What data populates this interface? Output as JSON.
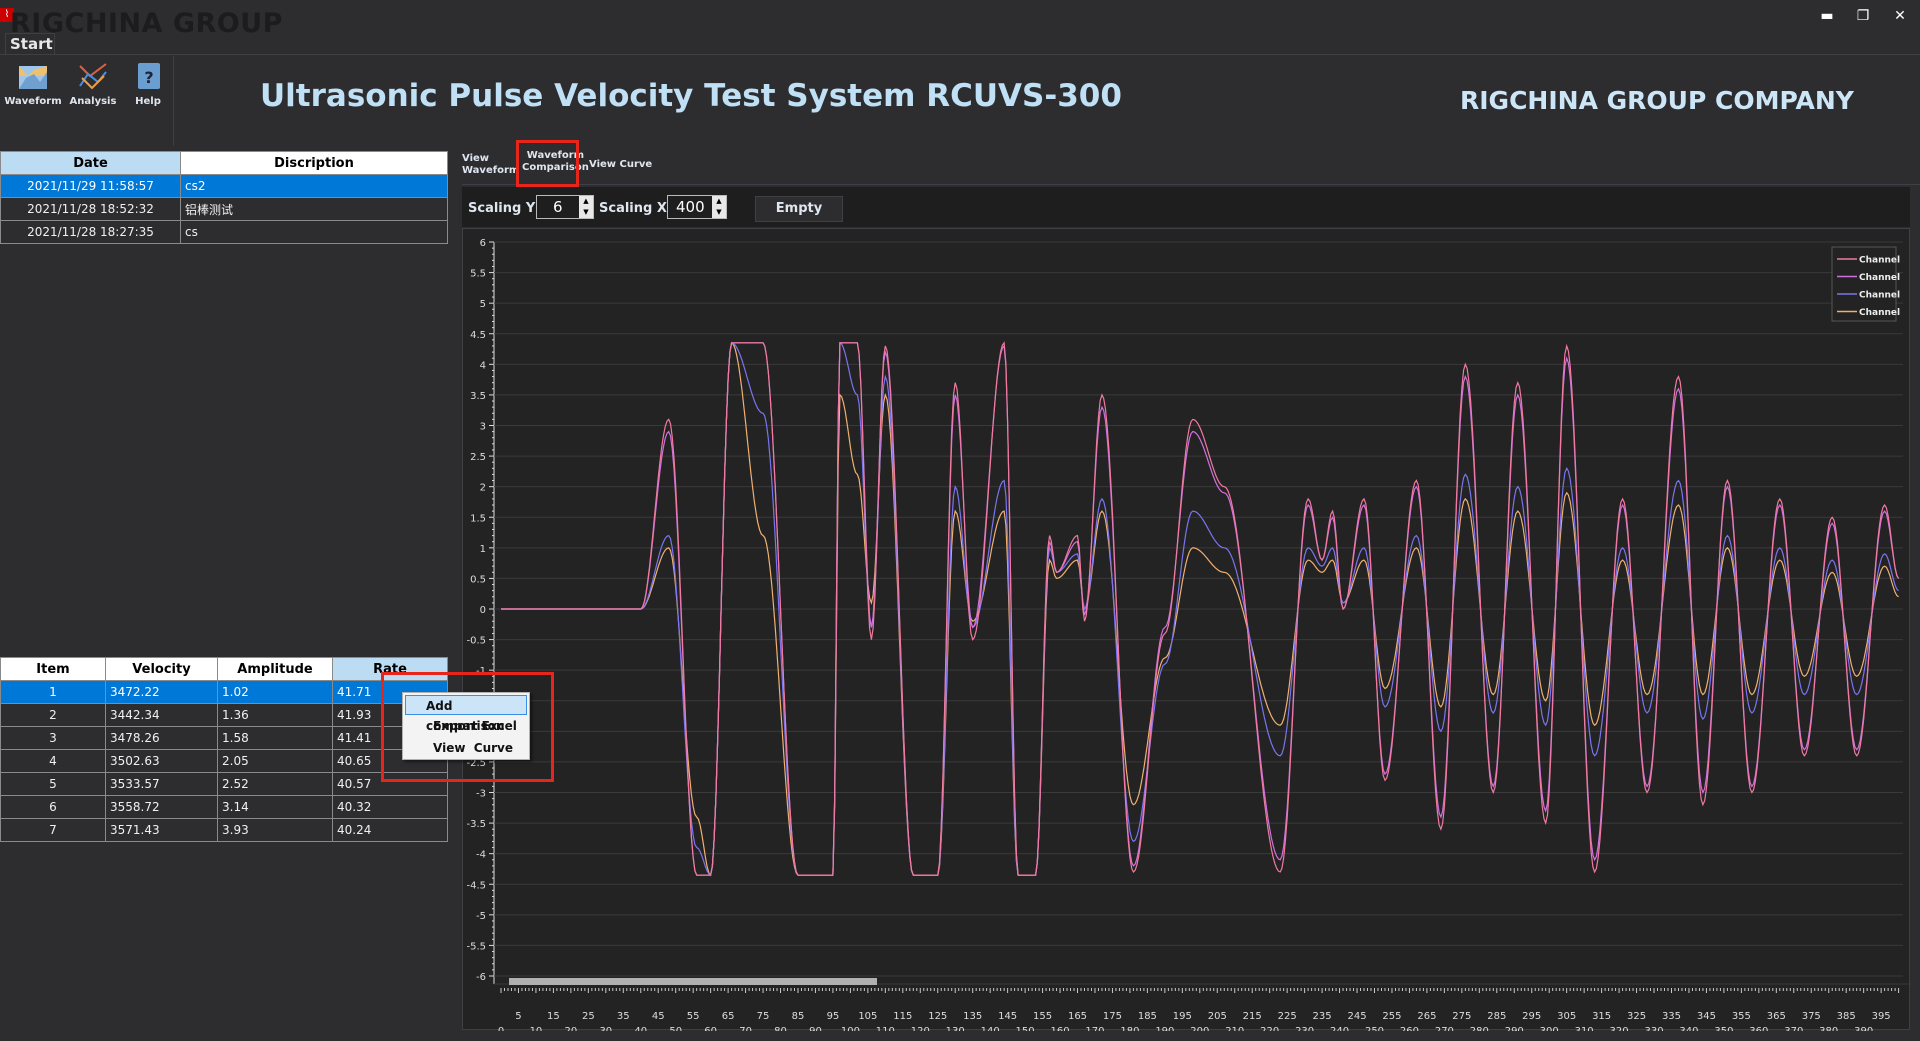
{
  "window": {
    "brand": "RIGCHINA GROUP",
    "app_icon": "pulse-icon",
    "minimize": "minimize-icon",
    "restore": "restore-icon",
    "close": "close-icon"
  },
  "ribbon": {
    "tab": "Start",
    "buttons": [
      {
        "label": "Waveform",
        "icon": "waveform-icon"
      },
      {
        "label": "Analysis",
        "icon": "analysis-icon"
      },
      {
        "label": "Help",
        "icon": "help-icon"
      }
    ]
  },
  "header": {
    "title": "Ultrasonic Pulse Velocity Test System RCUVS-300",
    "company": "RIGCHINA GROUP COMPANY"
  },
  "records": {
    "columns": [
      "Date",
      "Discription"
    ],
    "rows": [
      [
        "2021/11/29 11:58:57",
        "cs2"
      ],
      [
        "2021/11/28 18:52:32",
        "铝棒测试"
      ],
      [
        "2021/11/28 18:27:35",
        "cs"
      ]
    ],
    "selected": 0
  },
  "results": {
    "columns": [
      "Item",
      "Velocity",
      "Amplitude",
      "Rate"
    ],
    "rows": [
      [
        "1",
        "3472.22",
        "1.02",
        "41.71"
      ],
      [
        "2",
        "3442.34",
        "1.36",
        "41.93"
      ],
      [
        "3",
        "3478.26",
        "1.58",
        "41.41"
      ],
      [
        "4",
        "3502.63",
        "2.05",
        "40.65"
      ],
      [
        "5",
        "3533.57",
        "2.52",
        "40.57"
      ],
      [
        "6",
        "3558.72",
        "3.14",
        "40.32"
      ],
      [
        "7",
        "3571.43",
        "3.93",
        "40.24"
      ]
    ],
    "selected": 0
  },
  "tabs": [
    {
      "label": "View\nWaveform"
    },
    {
      "label": "Waveform\nComparison",
      "active": true
    },
    {
      "label": "View Curve"
    }
  ],
  "toolbar": {
    "scaling_y_label": "Scaling Y",
    "scaling_y": "6",
    "scaling_x_label": "Scaling X",
    "scaling_x": "400",
    "empty": "Empty"
  },
  "context_menu": [
    "Add comparison",
    "Export Excel",
    "View  Curve"
  ],
  "colors": {
    "accent": "#0078d7",
    "highlight": "#e8251b",
    "title": "#bfe0f5"
  },
  "chart_data": {
    "type": "line",
    "xlim": [
      0,
      400
    ],
    "ylim": [
      -6,
      6
    ],
    "y_step": 0.5,
    "grid": true,
    "legend": "top-right",
    "x_ticks_lower": [
      0,
      10,
      20,
      30,
      40,
      50,
      60,
      70,
      80,
      90,
      100,
      110,
      120,
      130,
      140,
      150,
      160,
      170,
      180,
      190,
      200,
      210,
      220,
      230,
      240,
      250,
      260,
      270,
      280,
      290,
      300,
      310,
      320,
      330,
      340,
      350,
      360,
      370,
      380,
      390
    ],
    "x_ticks_upper": [
      5,
      15,
      25,
      35,
      45,
      55,
      65,
      75,
      85,
      95,
      105,
      115,
      125,
      135,
      145,
      155,
      165,
      175,
      185,
      195,
      205,
      215,
      225,
      235,
      245,
      255,
      265,
      275,
      285,
      295,
      305,
      315,
      325,
      335,
      345,
      355,
      365,
      375,
      385,
      395
    ],
    "x": [
      0,
      40,
      48,
      56,
      60,
      66,
      75,
      85,
      95,
      97,
      102,
      106,
      110,
      118,
      125,
      130,
      135,
      144,
      148,
      153,
      157,
      159,
      165,
      167,
      172,
      181,
      190,
      198,
      207,
      223,
      231,
      235,
      238,
      241,
      247,
      253,
      262,
      269,
      276,
      284,
      291,
      299,
      305,
      313,
      321,
      328,
      337,
      344,
      351,
      358,
      366,
      373,
      381,
      388,
      396,
      400
    ],
    "series": [
      {
        "name": "Channel",
        "color": "#f07aa0",
        "values": [
          0,
          0,
          3.1,
          -4.35,
          -4.35,
          4.35,
          4.35,
          -4.35,
          -4.35,
          4.35,
          4.35,
          -0.5,
          4.3,
          -4.35,
          -4.35,
          3.7,
          -0.5,
          4.35,
          -4.35,
          -4.35,
          1.2,
          0.6,
          1.2,
          -0.2,
          3.5,
          -4.3,
          -0.4,
          3.1,
          2.0,
          -4.3,
          1.8,
          0.8,
          1.6,
          0,
          1.8,
          -2.8,
          2.1,
          -3.6,
          4.0,
          -3.0,
          3.7,
          -3.5,
          4.3,
          -4.3,
          1.8,
          -3.0,
          3.8,
          -3.2,
          2.1,
          -3.0,
          1.8,
          -2.4,
          1.5,
          -2.4,
          1.7,
          0.5
        ]
      },
      {
        "name": "Channel",
        "color": "#d070e0",
        "values": [
          0,
          0,
          2.9,
          -4.35,
          -4.35,
          4.35,
          4.35,
          -4.35,
          -4.35,
          4.35,
          4.35,
          -0.3,
          4.2,
          -4.35,
          -4.35,
          3.5,
          -0.3,
          4.3,
          -4.35,
          -4.35,
          1.1,
          0.6,
          1.1,
          -0.1,
          3.3,
          -4.2,
          -0.3,
          2.9,
          1.9,
          -4.1,
          1.7,
          0.8,
          1.5,
          0,
          1.7,
          -2.7,
          2.0,
          -3.4,
          3.8,
          -2.9,
          3.5,
          -3.3,
          4.1,
          -4.1,
          1.7,
          -2.9,
          3.6,
          -3.0,
          2.0,
          -2.9,
          1.7,
          -2.3,
          1.4,
          -2.3,
          1.6,
          0.5
        ]
      },
      {
        "name": "Channel",
        "color": "#7a74f0",
        "values": [
          0,
          0,
          1.2,
          -3.9,
          -4.35,
          4.35,
          3.2,
          -4.35,
          -4.35,
          4.35,
          3.5,
          -0.3,
          3.8,
          -4.35,
          -4.35,
          2.0,
          -0.3,
          2.1,
          -4.35,
          -4.35,
          1.0,
          0.6,
          0.9,
          0,
          1.8,
          -3.8,
          -0.9,
          1.6,
          1.0,
          -2.4,
          1.0,
          0.7,
          1.0,
          0.1,
          1.0,
          -1.6,
          1.2,
          -2.0,
          2.2,
          -1.7,
          2.0,
          -1.9,
          2.3,
          -2.4,
          1.0,
          -1.7,
          2.1,
          -1.8,
          1.2,
          -1.7,
          1.0,
          -1.4,
          0.8,
          -1.4,
          0.9,
          0.3
        ]
      },
      {
        "name": "Channel",
        "color": "#f0b070",
        "values": [
          0,
          0,
          1.0,
          -3.4,
          -4.35,
          4.35,
          1.2,
          -4.35,
          -4.35,
          3.5,
          2.2,
          0.1,
          3.5,
          -4.35,
          -4.35,
          1.6,
          -0.2,
          1.6,
          -4.35,
          -4.35,
          0.8,
          0.5,
          0.8,
          0,
          1.6,
          -3.2,
          -0.8,
          1.0,
          0.6,
          -1.9,
          0.8,
          0.6,
          0.8,
          0.1,
          0.8,
          -1.3,
          1.0,
          -1.6,
          1.8,
          -1.4,
          1.6,
          -1.5,
          1.9,
          -1.9,
          0.8,
          -1.4,
          1.7,
          -1.4,
          1.0,
          -1.4,
          0.8,
          -1.1,
          0.6,
          -1.1,
          0.7,
          0.2
        ]
      }
    ]
  }
}
